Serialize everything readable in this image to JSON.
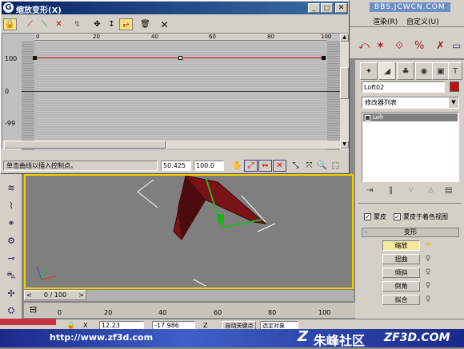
{
  "dialog": {
    "title": "缩放变形(X)",
    "ruler_labels": [
      "0",
      "20",
      "40",
      "60",
      "80",
      "100"
    ],
    "y_labels": [
      "100",
      "0",
      "-99"
    ],
    "status_text": "单击曲线以插入控制点。",
    "field_x": "50.425",
    "field_y": "100.0"
  },
  "menu": {
    "url_text": "BBS.JCWCN.COM",
    "render": "渲染(R)",
    "customize": "自定义(U)"
  },
  "panel": {
    "object_name": "Loft02",
    "modifier_list": "修改器列表",
    "stack_item": "Loft",
    "check_skin": "蒙皮",
    "check_skin_shade": "蒙皮于着色视图",
    "section_title": "变形",
    "buttons": [
      "缩放",
      "扭曲",
      "倾斜",
      "倒角",
      "拟合"
    ]
  },
  "timeline": {
    "frame": "0 / 100",
    "ticks": [
      "0",
      "20",
      "40",
      "60",
      "80",
      "100"
    ],
    "coord_x": "12.23",
    "coord_y": "-17.986",
    "coord_z_label": "Z",
    "auto_key": "自动关键点",
    "selected_obj": "选定对象"
  },
  "watermark": {
    "url": "http://www.zf3d.com",
    "cn": "朱峰社区",
    "site": "ZF3D.COM"
  },
  "colors": {
    "title_bar": "#0a246a",
    "curve": "#cc0000",
    "object": "#7a1218",
    "selection": "#ffffff",
    "accent": "#2f8f2f"
  }
}
